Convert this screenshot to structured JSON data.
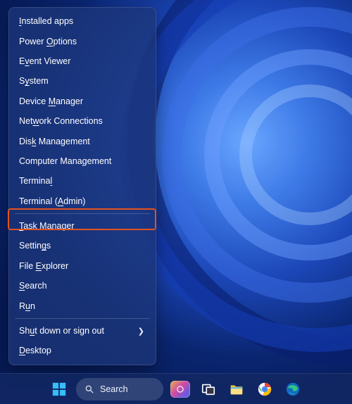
{
  "menu": {
    "items": [
      {
        "pre": "",
        "u": "I",
        "post": "nstalled apps"
      },
      {
        "pre": "Power ",
        "u": "O",
        "post": "ptions"
      },
      {
        "pre": "E",
        "u": "v",
        "post": "ent Viewer"
      },
      {
        "pre": "S",
        "u": "y",
        "post": "stem"
      },
      {
        "pre": "Device ",
        "u": "M",
        "post": "anager"
      },
      {
        "pre": "Net",
        "u": "w",
        "post": "ork Connections"
      },
      {
        "pre": "Dis",
        "u": "k",
        "post": " Management"
      },
      {
        "pre": "Computer Mana",
        "u": "g",
        "post": "ement"
      },
      {
        "pre": "Termina",
        "u": "l",
        "post": ""
      },
      {
        "pre": "Terminal (",
        "u": "A",
        "post": "dmin)",
        "highlighted": true
      },
      {
        "sep": true
      },
      {
        "pre": "",
        "u": "T",
        "post": "ask Manager"
      },
      {
        "pre": "Settin",
        "u": "g",
        "post": "s"
      },
      {
        "pre": "File ",
        "u": "E",
        "post": "xplorer"
      },
      {
        "pre": "",
        "u": "S",
        "post": "earch"
      },
      {
        "pre": "R",
        "u": "u",
        "post": "n"
      },
      {
        "sep": true
      },
      {
        "pre": "Sh",
        "u": "u",
        "post": "t down or sign out",
        "submenu": true
      },
      {
        "pre": "",
        "u": "D",
        "post": "esktop"
      }
    ]
  },
  "taskbar": {
    "search_label": "Search"
  }
}
